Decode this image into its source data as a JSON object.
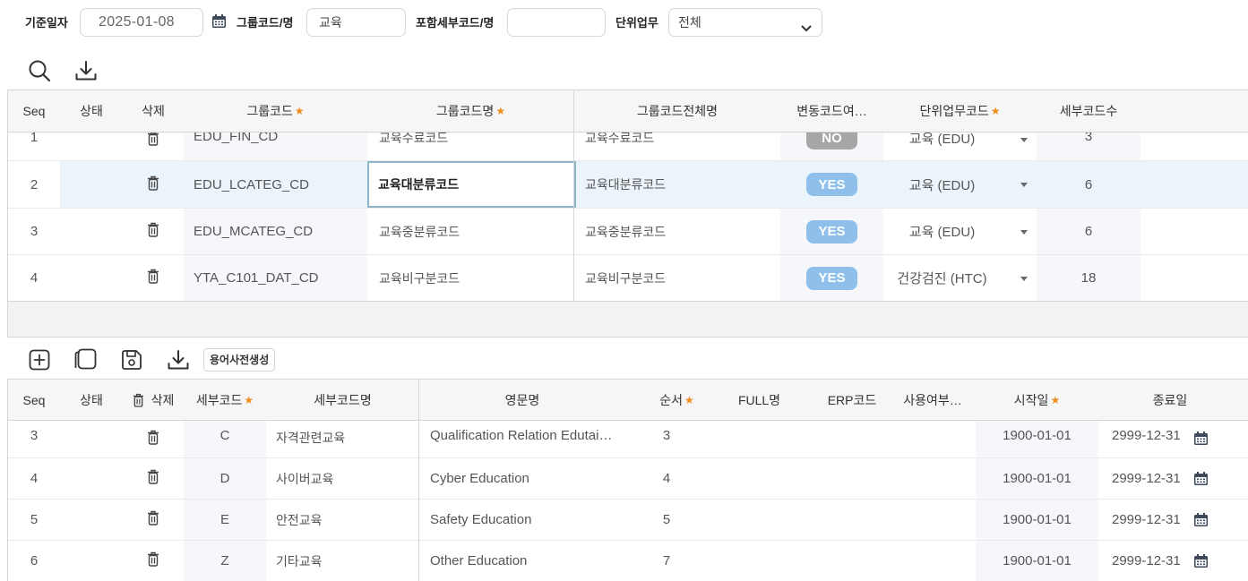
{
  "filters": {
    "base_date_label": "기준일자",
    "base_date_value": "2025-01-08",
    "group_code_label": "그룹코드/명",
    "group_code_value": "교육",
    "sub_code_label": "포함세부코드/명",
    "sub_code_value": "",
    "unit_work_label": "단위업무",
    "unit_work_value": "전체"
  },
  "group_grid": {
    "columns": {
      "seq": "Seq",
      "status": "상태",
      "delete": "삭제",
      "group_code": "그룹코드",
      "group_name": "그룹코드명",
      "group_full_name": "그룹코드전체명",
      "variable_yn": "변동코드여…",
      "unit_work_code": "단위업무코드",
      "detail_count": "세부코드수"
    },
    "rows": [
      {
        "seq": "1",
        "code": "EDU_FIN_CD",
        "name": "교육수료코드",
        "full_name": "교육수료코드",
        "variable": "NO",
        "unit": "교육 (EDU)",
        "count": "3"
      },
      {
        "seq": "2",
        "code": "EDU_LCATEG_CD",
        "name": "교육대분류코드",
        "full_name": "교육대분류코드",
        "variable": "YES",
        "unit": "교육 (EDU)",
        "count": "6"
      },
      {
        "seq": "3",
        "code": "EDU_MCATEG_CD",
        "name": "교육중분류코드",
        "full_name": "교육중분류코드",
        "variable": "YES",
        "unit": "교육 (EDU)",
        "count": "6"
      },
      {
        "seq": "4",
        "code": "YTA_C101_DAT_CD",
        "name": "교육비구분코드",
        "full_name": "교육비구분코드",
        "variable": "YES",
        "unit": "건강검진 (HTC)",
        "count": "18"
      }
    ]
  },
  "detail_toolbar": {
    "dictionary_button": "용어사전생성"
  },
  "detail_grid": {
    "columns": {
      "seq": "Seq",
      "status": "상태",
      "delete": "삭제",
      "detail_code": "세부코드",
      "detail_name": "세부코드명",
      "english_name": "영문명",
      "order": "순서",
      "full_name": "FULL명",
      "erp_code": "ERP코드",
      "use_yn": "사용여부…",
      "start_date": "시작일",
      "end_date": "종료일"
    },
    "rows": [
      {
        "seq": "3",
        "code": "C",
        "name": "자격관련교육",
        "english": "Qualification Relation Edutai…",
        "order": "3",
        "start": "1900-01-01",
        "end": "2999-12-31"
      },
      {
        "seq": "4",
        "code": "D",
        "name": "사이버교육",
        "english": "Cyber Education",
        "order": "4",
        "start": "1900-01-01",
        "end": "2999-12-31"
      },
      {
        "seq": "5",
        "code": "E",
        "name": "안전교육",
        "english": "Safety Education",
        "order": "5",
        "start": "1900-01-01",
        "end": "2999-12-31"
      },
      {
        "seq": "6",
        "code": "Z",
        "name": "기타교육",
        "english": "Other Education",
        "order": "7",
        "start": "1900-01-01",
        "end": "2999-12-31"
      }
    ]
  },
  "colors": {
    "accent_star": "#f08c1a",
    "yes_badge": "#8fc0ec",
    "no_badge": "#a6a6a6",
    "selected_row": "#eaf4fa"
  },
  "icons": [
    "calendar-icon",
    "chevron-down-icon",
    "search-icon",
    "download-icon",
    "add-icon",
    "copy-icon",
    "save-icon",
    "trash-icon"
  ]
}
